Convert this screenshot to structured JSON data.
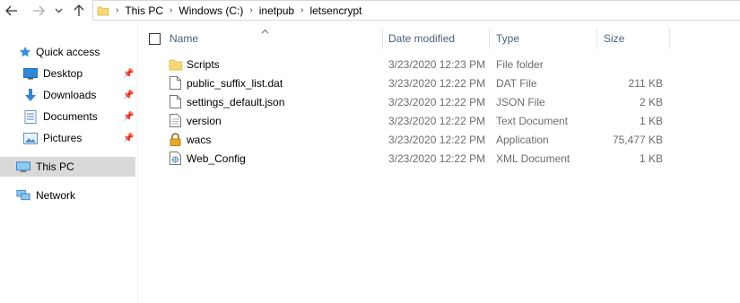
{
  "address": {
    "crumbs": [
      "This PC",
      "Windows (C:)",
      "inetpub",
      "letsencrypt"
    ]
  },
  "sidebar": {
    "items": [
      {
        "label": "Quick access",
        "icon": "star-icon"
      },
      {
        "label": "Desktop",
        "icon": "desktop-icon",
        "pinned": true
      },
      {
        "label": "Downloads",
        "icon": "download-icon",
        "pinned": true
      },
      {
        "label": "Documents",
        "icon": "documents-icon",
        "pinned": true
      },
      {
        "label": "Pictures",
        "icon": "pictures-icon",
        "pinned": true
      },
      {
        "label": "This PC",
        "icon": "computer-icon",
        "selected": true
      },
      {
        "label": "Network",
        "icon": "network-icon"
      }
    ]
  },
  "columns": {
    "name": "Name",
    "date": "Date modified",
    "type": "Type",
    "size": "Size"
  },
  "files": [
    {
      "name": "Scripts",
      "date": "3/23/2020 12:23 PM",
      "type": "File folder",
      "size": "",
      "icon": "folder-icon"
    },
    {
      "name": "public_suffix_list.dat",
      "date": "3/23/2020 12:22 PM",
      "type": "DAT File",
      "size": "211 KB",
      "icon": "file-icon"
    },
    {
      "name": "settings_default.json",
      "date": "3/23/2020 12:22 PM",
      "type": "JSON File",
      "size": "2 KB",
      "icon": "file-icon"
    },
    {
      "name": "version",
      "date": "3/23/2020 12:22 PM",
      "type": "Text Document",
      "size": "1 KB",
      "icon": "text-file-icon"
    },
    {
      "name": "wacs",
      "date": "3/23/2020 12:22 PM",
      "type": "Application",
      "size": "75,477 KB",
      "icon": "lock-icon"
    },
    {
      "name": "Web_Config",
      "date": "3/23/2020 12:22 PM",
      "type": "XML Document",
      "size": "1 KB",
      "icon": "xml-file-icon"
    }
  ],
  "colors": {
    "selection": "#cce8ff",
    "sidebar_selected": "#d9d9d9",
    "folder": "#f8d775",
    "header_text": "#4c607a"
  }
}
